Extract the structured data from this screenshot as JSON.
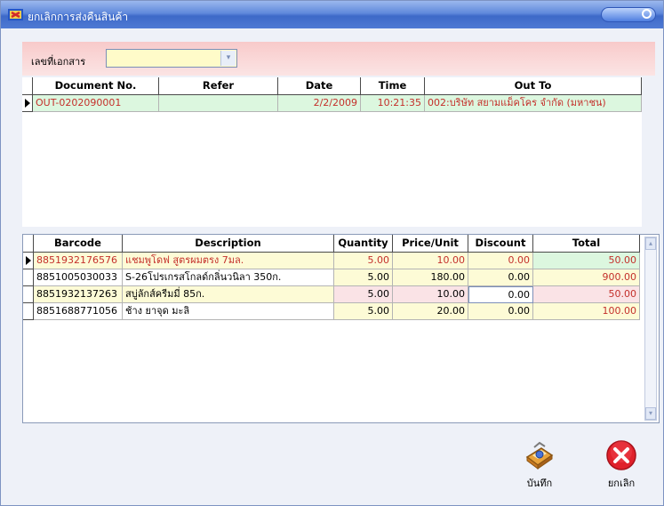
{
  "window": {
    "title": "ยกเลิกการส่งคืนสินค้า"
  },
  "filter": {
    "label": "เลขที่เอกสาร",
    "value": ""
  },
  "documents": {
    "columns": [
      "Document No.",
      "Refer",
      "Date",
      "Time",
      "Out To"
    ],
    "rows": [
      {
        "document_no": "OUT-0202090001",
        "refer": "",
        "date": "2/2/2009",
        "time": "10:21:35",
        "out_to": "002:บริษัท สยามแม็คโคร จำกัด (มหาชน)"
      }
    ]
  },
  "items": {
    "columns": [
      "Barcode",
      "Description",
      "Quantity",
      "Price/Unit",
      "Discount",
      "Total"
    ],
    "rows": [
      {
        "barcode": "8851932176576",
        "description": "แชมพูโดฟ สูตรผมตรง 7มล.",
        "quantity": "5.00",
        "price": "10.00",
        "discount": "0.00",
        "total": "50.00"
      },
      {
        "barcode": "8851005030033",
        "description": "S-26โปรเกรสโกลด์กลิ่นวนิลา 350ก.",
        "quantity": "5.00",
        "price": "180.00",
        "discount": "0.00",
        "total": "900.00"
      },
      {
        "barcode": "8851932137263",
        "description": "สบู่ลักส์ครีมมี่ 85ก.",
        "quantity": "5.00",
        "price": "10.00",
        "discount": "0.00",
        "total": "50.00"
      },
      {
        "barcode": "8851688771056",
        "description": "ช้าง ยาจุด มะลิ",
        "quantity": "5.00",
        "price": "20.00",
        "discount": "0.00",
        "total": "100.00"
      }
    ]
  },
  "actions": {
    "save_label": "บันทึก",
    "cancel_label": "ยกเลิก"
  },
  "colors": {
    "row_green": "#dcf7df",
    "row_yellow": "#fdfbd6",
    "row_pink": "#fae3e6",
    "accent_red": "#c4302b"
  }
}
